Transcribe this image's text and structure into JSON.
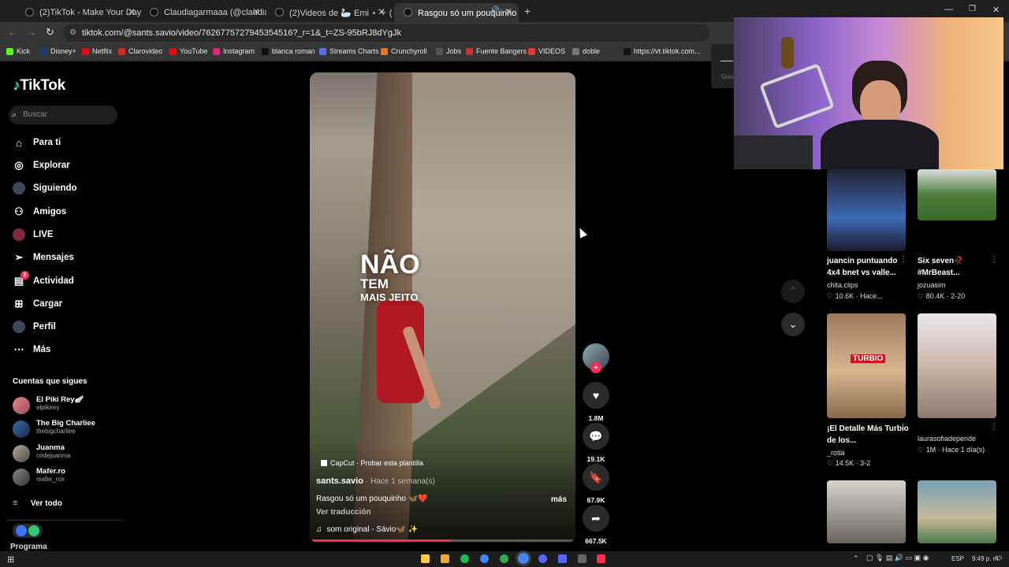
{
  "browser": {
    "tabs": [
      {
        "label": "(2)TikTok - Make Your Day"
      },
      {
        "label": "Claudiagarmaaa (@claudiagarm"
      },
      {
        "label": "(2)Videos de 🦢 Emi ⋆˙✧ (@lly"
      },
      {
        "label": "Rasgou só um pouquinho 🦋"
      }
    ],
    "new_tab": "+",
    "url": "tiktok.com/@sants.savio/video/7626775727945354516?_r=1&_t=ZS-95bRJ8dYgJk",
    "bookmarks": [
      {
        "label": "Kick",
        "color": "#53fc18"
      },
      {
        "label": "Disney+",
        "color": "#1b3a8c"
      },
      {
        "label": "Netflix",
        "color": "#e50914"
      },
      {
        "label": "Clarovideo",
        "color": "#da291c"
      },
      {
        "label": "YouTube",
        "color": "#ff0000"
      },
      {
        "label": "Instagram",
        "color": "#d62976"
      },
      {
        "label": "blanca roman",
        "color": "#111111"
      },
      {
        "label": "Streams Charts",
        "color": "#5a6cff"
      },
      {
        "label": "Crunchyroll",
        "color": "#f47521"
      },
      {
        "label": "Jobs",
        "color": "#555555"
      },
      {
        "label": "Fuente Bangers",
        "color": "#d93025"
      },
      {
        "label": "VIDEOS",
        "color": "#e53935"
      },
      {
        "label": "doble",
        "color": "#777777"
      },
      {
        "label": "https://vt.tiktok.com...",
        "color": "#111111"
      }
    ]
  },
  "tiktok": {
    "logo": "TikTok",
    "search_placeholder": "Buscar",
    "nav": [
      {
        "label": "Para ti",
        "icon": "home-icon"
      },
      {
        "label": "Explorar",
        "icon": "compass-icon"
      },
      {
        "label": "Siguiendo",
        "icon": "following-icon"
      },
      {
        "label": "Amigos",
        "icon": "friends-icon"
      },
      {
        "label": "LIVE",
        "icon": "live-icon"
      },
      {
        "label": "Mensajes",
        "icon": "send-icon"
      },
      {
        "label": "Actividad",
        "icon": "activity-icon",
        "badge": "2"
      },
      {
        "label": "Cargar",
        "icon": "upload-icon"
      },
      {
        "label": "Perfil",
        "icon": "profile-icon"
      },
      {
        "label": "Más",
        "icon": "more-icon"
      }
    ],
    "following_title": "Cuentas que sigues",
    "accounts": [
      {
        "name": "El Piki Rey🪽",
        "handle": "elpikirey"
      },
      {
        "name": "The Big Charliee",
        "handle": "thebigcharliee"
      },
      {
        "name": "Juanma",
        "handle": "codejuanma"
      },
      {
        "name": "Mafer.ro",
        "handle": "mafer_rox"
      }
    ],
    "see_all": "Ver todo",
    "programa": "Programa"
  },
  "video": {
    "overlay_line1": "NÃO",
    "overlay_line2": "TEM",
    "overlay_line3": "MAIS JEITO",
    "template": "CapCut · Probar esta plantilla",
    "author": "sants.savio",
    "time": "· Hace 1 semana(s)",
    "caption": "Rasgou só um pouquinho 🦋❤️",
    "more": "más",
    "translate": "Ver traducción",
    "sound": "som original - Sávio🦋 ✨",
    "progress": 0.53,
    "actions": {
      "likes": "1.8M",
      "comments": "19.1K",
      "saves": "67.9K",
      "shares": "667.5K"
    }
  },
  "grid": [
    {
      "title": "juancin puntuando 4x4 bnet vs valle...",
      "author": "chita.clips",
      "stats": "♡ 10.6K · Hace..."
    },
    {
      "title": "Six seven🥀 #MrBeast...",
      "author": "jozuasim",
      "stats": "♡ 80.4K · 2-20"
    },
    {
      "title": "¡El Detalle Más Turbio de los...",
      "author": "_rotia",
      "stats": "♡ 14.5K · 3-2"
    },
    {
      "title": "",
      "author": "laurasofiadepende",
      "stats": "♡ 1M · Hace 1 día(s)"
    }
  ],
  "thumb_overlay": "TURBIO",
  "webcam_hint": "Goo",
  "taskbar": {
    "lang": "ESP",
    "time": "9:49 p. m."
  }
}
